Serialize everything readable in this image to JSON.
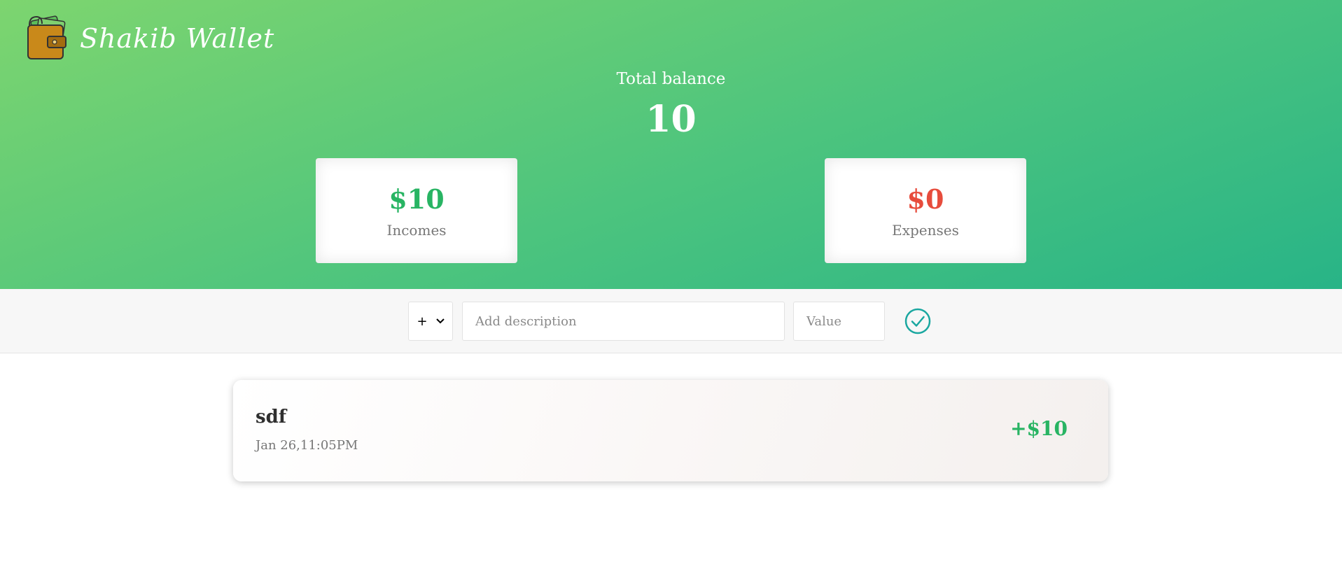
{
  "app": {
    "name": "Shakib Wallet",
    "logo_icon": "wallet-icon"
  },
  "colors": {
    "income": "#28b463",
    "expense": "#e74c3c",
    "accent": "#1aa7a0",
    "header_start": "#7dd56f",
    "header_end": "#28b487"
  },
  "balance": {
    "label": "Total balance",
    "value": "10"
  },
  "summary": {
    "income": {
      "amount": "$10",
      "label": "Incomes"
    },
    "expense": {
      "amount": "$0",
      "label": "Expenses"
    }
  },
  "add_form": {
    "type_value": "+",
    "description_placeholder": "Add description",
    "value_placeholder": "Value",
    "submit_icon": "check-circle-icon"
  },
  "transactions": [
    {
      "description": "sdf",
      "date": "Jan 26,11:05PM",
      "amount": "+$10",
      "type": "income"
    }
  ]
}
